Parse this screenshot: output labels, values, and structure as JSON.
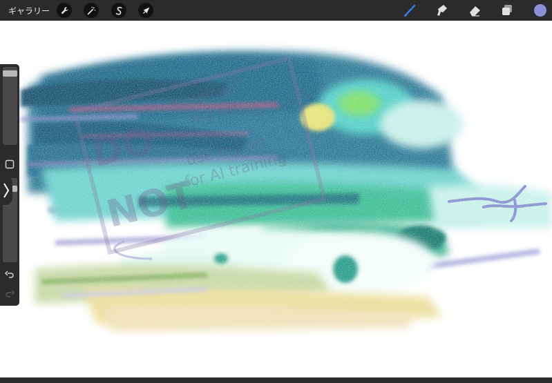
{
  "toolbar": {
    "gallery_label": "ギャラリー",
    "left_tools": [
      {
        "name": "adjustments",
        "icon": "wrench-icon"
      },
      {
        "name": "selection-magic",
        "icon": "magic-wand-icon"
      },
      {
        "name": "selection",
        "icon": "s-curve-icon"
      },
      {
        "name": "transform",
        "icon": "arrow-cursor-icon"
      }
    ],
    "right_tools": [
      {
        "name": "brush",
        "icon": "brush-icon",
        "active": true
      },
      {
        "name": "smudge",
        "icon": "smudge-icon"
      },
      {
        "name": "eraser",
        "icon": "eraser-icon"
      },
      {
        "name": "layers",
        "icon": "layers-icon"
      }
    ],
    "color": "#8a8fd8",
    "accent": "#2f7fe8"
  },
  "sidebar": {
    "brush_size_level": 0.05,
    "opacity_level": 0.1,
    "buttons": [
      "square-modifier-icon",
      "undo-icon",
      "redo-icon"
    ]
  },
  "watermark": {
    "lines": [
      "DO",
      "NOT",
      "reupload",
      "my art",
      "use my art",
      "for AI training"
    ]
  }
}
